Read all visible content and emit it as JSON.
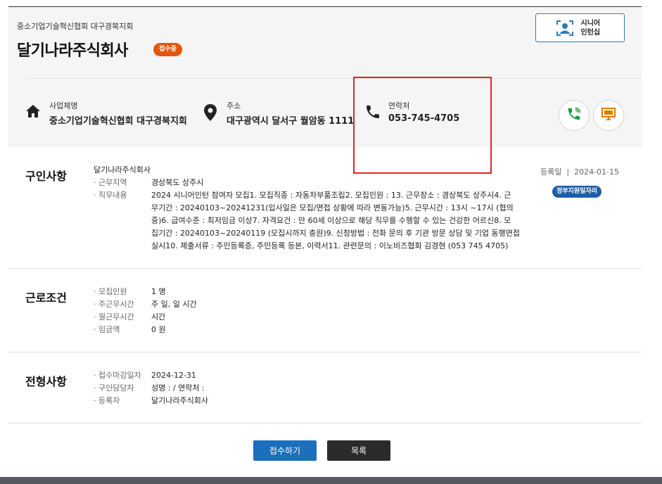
{
  "header": {
    "org_name": "중소기업기술혁신협회 대구경북지회",
    "company_name": "달기나라주식회사",
    "status_badge": "접수중",
    "senior_internship_line1": "시니어",
    "senior_internship_line2": "인턴십"
  },
  "info": {
    "business_label": "사업체명",
    "business_value": "중소기업기술혁신협회 대구경북지회",
    "address_label": "주소",
    "address_value": "대구광역시 달서구 월암동 1111",
    "contact_label": "연락처",
    "contact_value": "053-745-4705"
  },
  "job_posting": {
    "title": "구인사항",
    "company": "달기나라주식회사",
    "work_area_label": "· 근무지역",
    "work_area_value": "경상북도 상주시",
    "job_desc_label": "· 직무내용",
    "job_desc_lines": [
      "2024 시니어인턴 참여자 모집1. 모집직종 : 자동차부품조립2. 모집인원 : 13. 근무장소 : 경상북도 상주시4. 근",
      "무기간 : 20240103~20241231(입사일은 모집/면접 상황에 따라 변동가능)5. 근무시간 : 13시 ~17시 (협의",
      "중)6. 급여수준 : 최저임금 이상7. 자격요건 : 만 60세 이상으로 해당 직무를 수행할 수 있는 건강한 어르신8. 모",
      "집기간 : 20240103~20240119 (모집시까지 충원)9. 신청방법 : 전화 문의 후 기관 방문 상담 및 기업 동행면접",
      "실시10. 제출서류 : 주민등록증, 주민등록 등본, 이력서11. 관련문의 : 이노비즈협회 김경현 (053 745 4705)"
    ],
    "reg_date_label": "등록일",
    "reg_date_sep": "|",
    "reg_date_value": "2024-01-15",
    "gov_badge": "정부지원일자리"
  },
  "work_conditions": {
    "title": "근로조건",
    "rows": [
      {
        "key": "· 모집인원",
        "value": "1 명"
      },
      {
        "key": "· 주근무시간",
        "value": "주 일, 일 시간"
      },
      {
        "key": "· 월근무시간",
        "value": "시간"
      },
      {
        "key": "· 임금액",
        "value": "0 원"
      }
    ]
  },
  "screening": {
    "title": "전형사항",
    "rows": [
      {
        "key": "· 접수마감일자",
        "value": "2024-12-31"
      },
      {
        "key": "· 구인담당자",
        "value": "성명 : / 연락처 :"
      },
      {
        "key": "· 등록자",
        "value": "달기나라주식회사"
      }
    ]
  },
  "buttons": {
    "apply": "접수하기",
    "list": "목록"
  },
  "icons": {
    "home": "home-icon",
    "pin": "location-pin-icon",
    "phone": "phone-icon",
    "call": "call-icon",
    "monitor": "monitor-icon",
    "senior": "senior-person-icon"
  },
  "colors": {
    "status": "#e2570c",
    "primary": "#1c6fba",
    "gov_badge": "#1c5ea8",
    "highlight": "#e8212b"
  }
}
